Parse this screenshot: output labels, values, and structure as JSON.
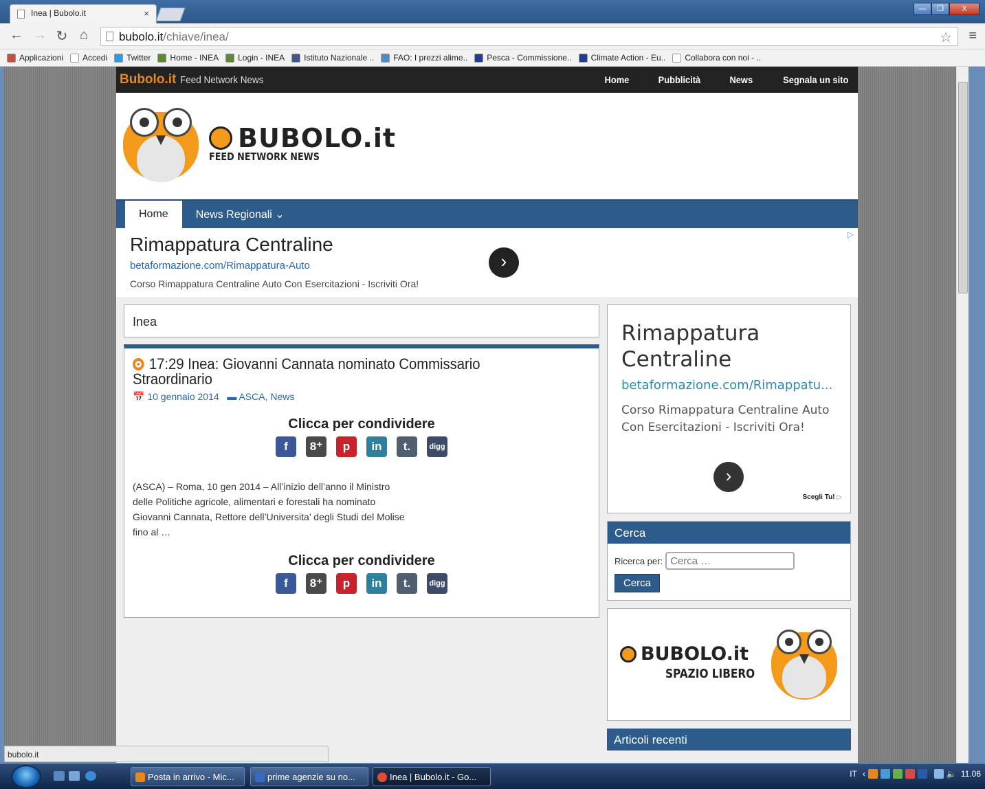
{
  "browser": {
    "tab_title": "Inea | Bubolo.it",
    "tab_close": "×",
    "url_host": "bubolo.it",
    "url_path": "/chiave/inea/",
    "status_url": "bubolo.it",
    "window_buttons": [
      "—",
      "❐",
      "X"
    ],
    "bookmarks": [
      {
        "label": "Applicazioni",
        "color": "#d14b3a"
      },
      {
        "label": "Accedi",
        "color": "#ffffff"
      },
      {
        "label": "Twitter",
        "color": "#1da1f2"
      },
      {
        "label": "Home - INEA",
        "color": "#5a8a2a"
      },
      {
        "label": "Login - INEA",
        "color": "#5a8a2a"
      },
      {
        "label": "Istituto Nazionale ..",
        "color": "#3b5998"
      },
      {
        "label": "FAO: I prezzi alime..",
        "color": "#4b8ccf"
      },
      {
        "label": "Pesca - Commissione..",
        "color": "#1f3e9c"
      },
      {
        "label": "Climate Action - Eu..",
        "color": "#1f3e9c"
      },
      {
        "label": "Collabora con noi - ..",
        "color": "#ffffff"
      }
    ]
  },
  "site": {
    "brand": "Bubolo.it",
    "tagline": "Feed Network News",
    "top_links": [
      "Home",
      "Pubblicità",
      "News",
      "Segnala un sito"
    ],
    "logo_main": "BUBOLO.it",
    "logo_sub": "FEED NETWORK NEWS",
    "nav": {
      "home": "Home",
      "regional": "News Regionali ⌄"
    },
    "ad": {
      "title": "Rimappatura Centraline",
      "url": "betaformazione.com/Rimappatura-Auto",
      "desc": "Corso Rimappatura Centraline Auto Con Esercitazioni - Iscriviti Ora!",
      "arrow": "›",
      "choice": "▷"
    },
    "archive_title": "Inea",
    "post": {
      "title": "17:29 Inea: Giovanni Cannata nominato Commissario Straordinario",
      "date": "📅 10 gennaio 2014",
      "categories": "▬ ASCA, News",
      "share_heading": "Clicca per condividere",
      "share_icons": [
        {
          "name": "facebook",
          "glyph": "f",
          "color": "#3b5998"
        },
        {
          "name": "googleplus",
          "glyph": "8⁺",
          "color": "#4a4a4a"
        },
        {
          "name": "pinterest",
          "glyph": "p",
          "color": "#c8232c"
        },
        {
          "name": "linkedin",
          "glyph": "in",
          "color": "#2f7f9e"
        },
        {
          "name": "tumblr",
          "glyph": "t.",
          "color": "#4f5f6f"
        },
        {
          "name": "digg",
          "glyph": "digg",
          "color": "#3d4a6a"
        }
      ],
      "excerpt": "(ASCA) – Roma, 10 gen 2014 – All’inizio dell’anno il Ministro delle Politiche agricole, alimentari e forestali ha nominato Giovanni Cannata, Rettore dell’Universita’ degli Studi del Molise fino al …"
    },
    "sidebar": {
      "ad_title": "Rimappatura Centraline",
      "ad_url": "betaformazione.com/Rimappatu...",
      "ad_desc": "Corso Rimappatura Centraline Auto Con Esercitazioni - Iscriviti Ora!",
      "ad_choice": "Scegli Tu!",
      "ad_choice_icon": "▷",
      "search_title": "Cerca",
      "search_label": "Ricerca per:",
      "search_placeholder": "Cerca …",
      "search_button": "Cerca",
      "spazio_main": "BUBOLO.it",
      "spazio_sub": "SPAZIO LIBERO",
      "recent_title": "Articoli recenti"
    }
  },
  "taskbar": {
    "tasks": [
      "Posta in arrivo - Mic...",
      "prime agenzie su no...",
      "Inea | Bubolo.it - Go..."
    ],
    "lang": "IT",
    "clock": "11.06"
  }
}
